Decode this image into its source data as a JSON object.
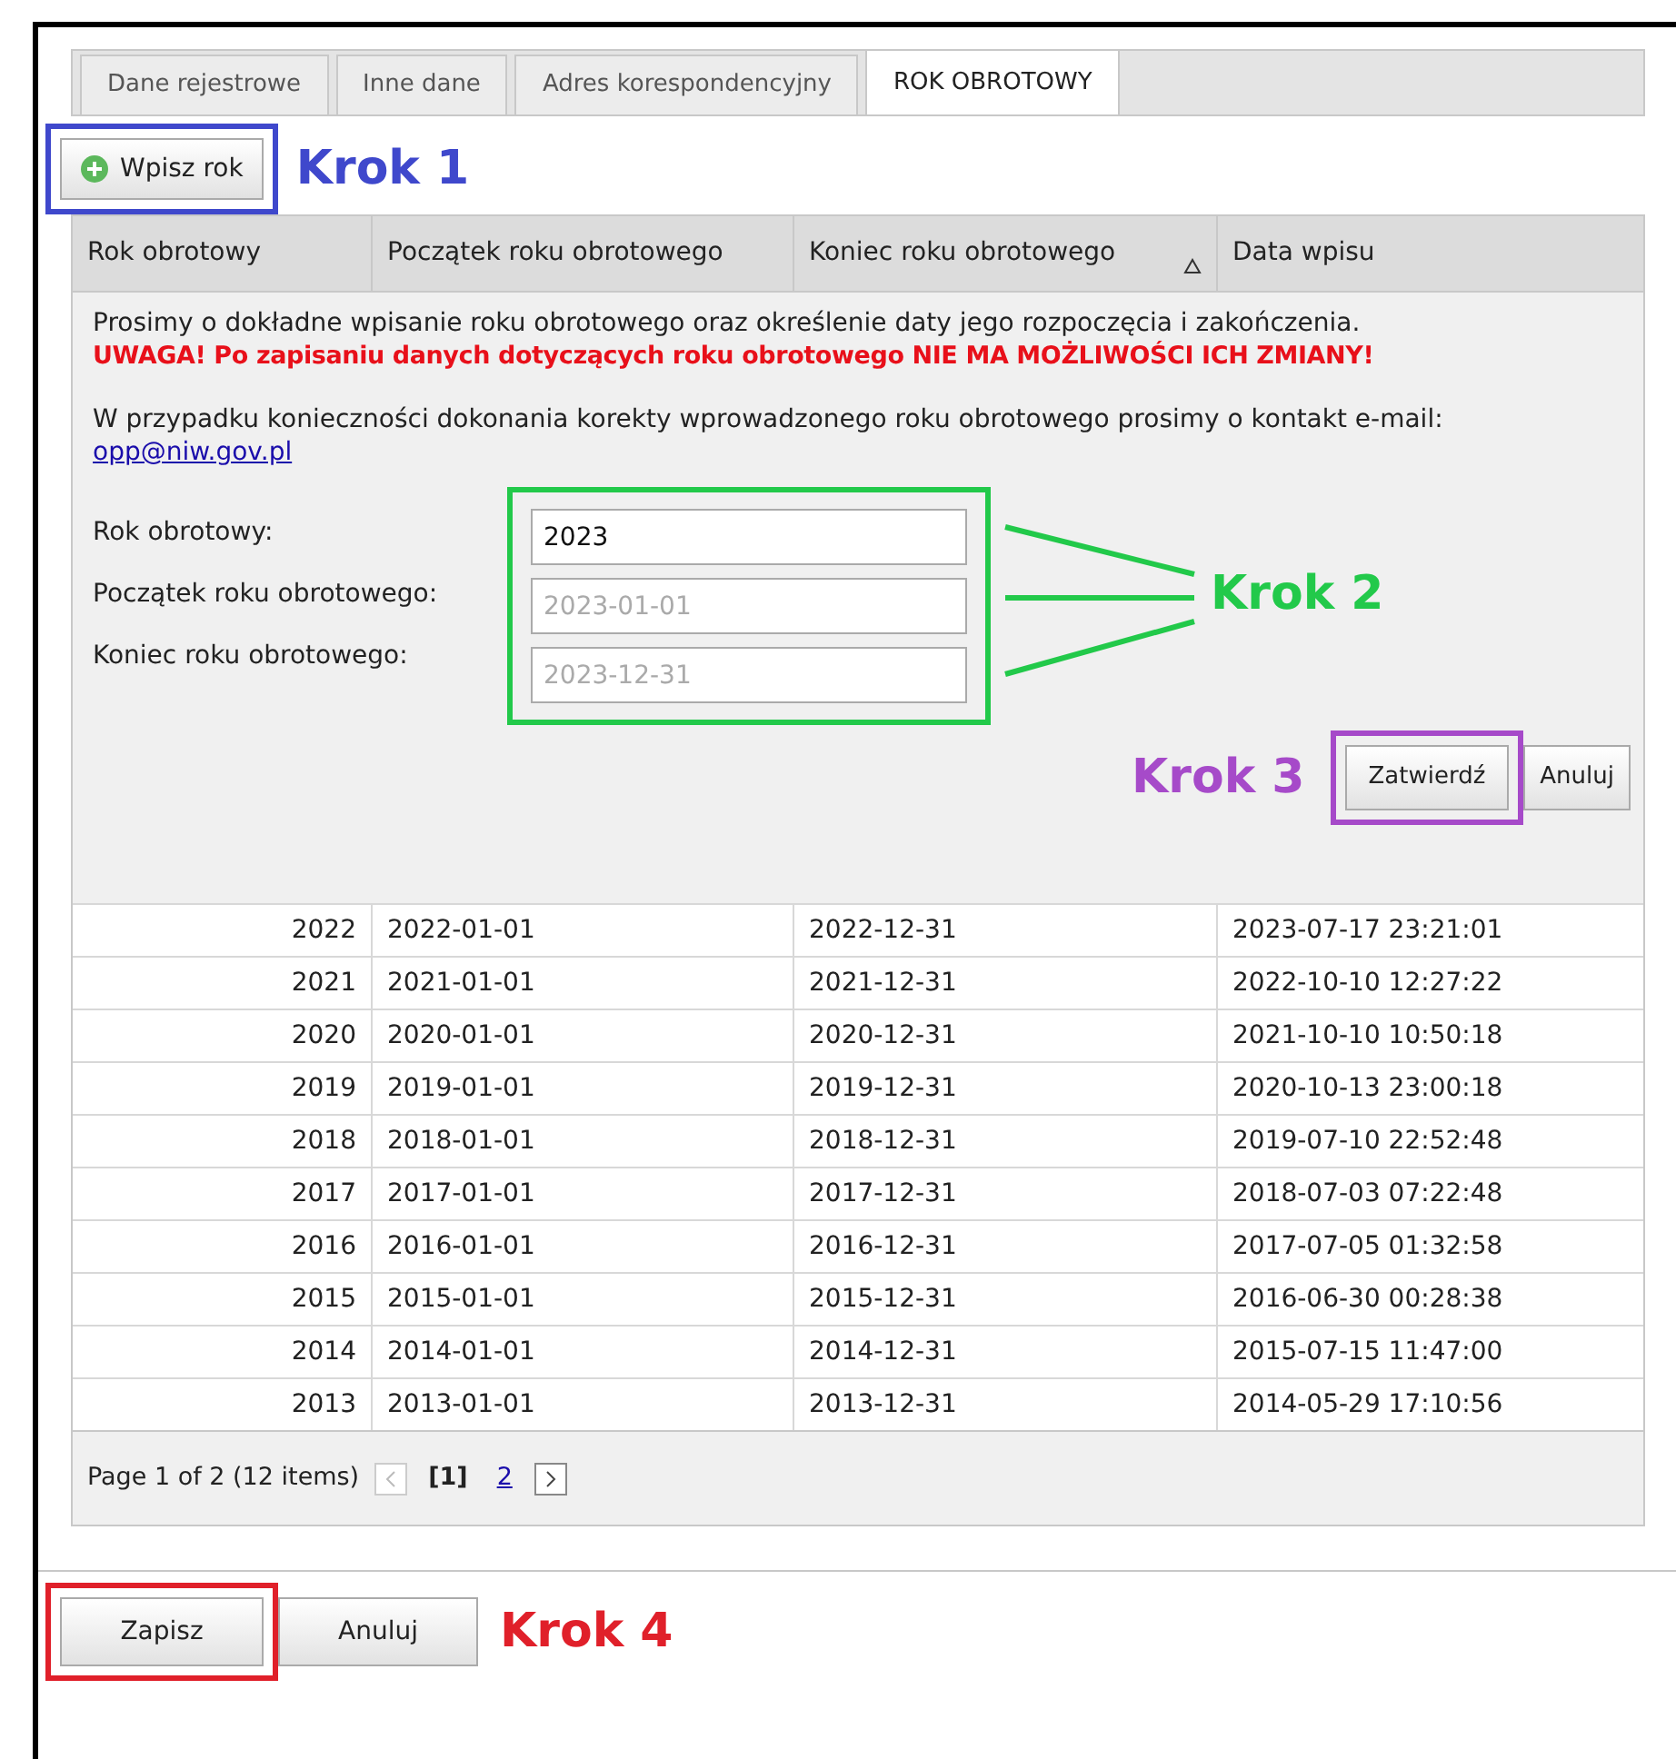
{
  "tabs": [
    {
      "label": "Dane rejestrowe",
      "selected": false
    },
    {
      "label": "Inne dane",
      "selected": false
    },
    {
      "label": "Adres korespondencyjny",
      "selected": false
    },
    {
      "label": "ROK OBROTOWY",
      "selected": true
    }
  ],
  "add_button": "Wpisz rok",
  "annotations": [
    {
      "text": "Krok 1",
      "color": "#3f48cc"
    },
    {
      "text": "Krok 2",
      "color": "#22c94a"
    },
    {
      "text": "Krok 3",
      "color": "#a64ac9"
    },
    {
      "text": "Krok 4",
      "color": "#e0202a"
    }
  ],
  "table": {
    "columns": [
      {
        "label": "Rok obrotowy",
        "sorted": false
      },
      {
        "label": "Początek roku obrotowego",
        "sorted": false
      },
      {
        "label": "Koniec roku obrotowego",
        "sorted": true
      },
      {
        "label": "Data wpisu",
        "sorted": false
      }
    ],
    "form": {
      "info": "Prosimy o dokładne wpisanie roku obrotowego oraz określenie daty jego rozpoczęcia i zakończenia.",
      "warning": "UWAGA! Po zapisaniu danych dotyczących roku obrotowego NIE MA MOŻLIWOŚCI ICH ZMIANY!",
      "contact": "W przypadku konieczności dokonania korekty wprowadzonego roku obrotowego prosimy o kontakt e-mail:",
      "email": "opp@niw.gov.pl",
      "fields": [
        {
          "label": "Rok obrotowy:",
          "value": "2023"
        },
        {
          "label": "Początek roku obrotowego:",
          "placeholder": "2023-01-01"
        },
        {
          "label": "Koniec roku obrotowego:",
          "placeholder": "2023-12-31"
        }
      ],
      "confirm": "Zatwierdź",
      "cancel": "Anuluj"
    },
    "rows": [
      [
        "2022",
        "2022-01-01",
        "2022-12-31",
        "2023-07-17 23:21:01"
      ],
      [
        "2021",
        "2021-01-01",
        "2021-12-31",
        "2022-10-10 12:27:22"
      ],
      [
        "2020",
        "2020-01-01",
        "2020-12-31",
        "2021-10-10 10:50:18"
      ],
      [
        "2019",
        "2019-01-01",
        "2019-12-31",
        "2020-10-13 23:00:18"
      ],
      [
        "2018",
        "2018-01-01",
        "2018-12-31",
        "2019-07-10 22:52:48"
      ],
      [
        "2017",
        "2017-01-01",
        "2017-12-31",
        "2018-07-03 07:22:48"
      ],
      [
        "2016",
        "2016-01-01",
        "2016-12-31",
        "2017-07-05 01:32:58"
      ],
      [
        "2015",
        "2015-01-01",
        "2015-12-31",
        "2016-06-30 00:28:38"
      ],
      [
        "2014",
        "2014-01-01",
        "2014-12-31",
        "2015-07-15 11:47:00"
      ],
      [
        "2013",
        "2013-01-01",
        "2013-12-31",
        "2014-05-29 17:10:56"
      ]
    ],
    "pager": {
      "summary": "Page 1 of 2 (12 items)",
      "prev_disabled": true,
      "pages": [
        {
          "label": "[1]",
          "selected": true
        },
        {
          "label": "2",
          "selected": false
        }
      ]
    }
  },
  "footer_buttons": [
    "Zapisz",
    "Anuluj"
  ]
}
